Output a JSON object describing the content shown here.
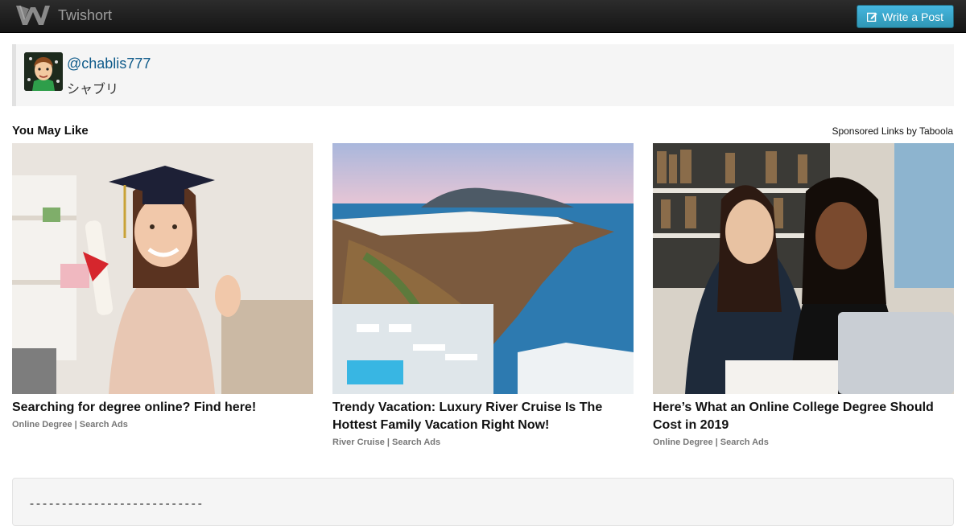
{
  "navbar": {
    "brand": "Twishort",
    "write_label": "Write a Post"
  },
  "author": {
    "handle": "@chablis777",
    "name": "シャブリ"
  },
  "recommendations": {
    "title": "You May Like",
    "sponsored": "Sponsored Links by Taboola",
    "items": [
      {
        "headline": "Searching for degree online? Find here!",
        "source": "Online Degree | Search Ads"
      },
      {
        "headline": "Trendy Vacation: Luxury River Cruise Is The Hottest Family Vacation Right Now!",
        "source": "River Cruise | Search Ads"
      },
      {
        "headline": "Here’s What an Online College Degree Should Cost in 2019",
        "source": "Online Degree | Search Ads"
      }
    ]
  },
  "post": {
    "dashes": "---------------------------"
  },
  "colors": {
    "navbar": "#1b1b1b",
    "button": "#3ba7cf",
    "link": "#0e5a8a"
  }
}
